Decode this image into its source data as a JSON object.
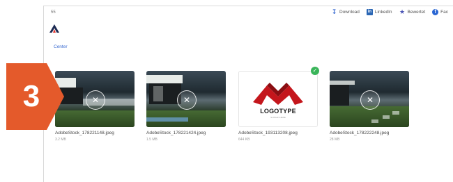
{
  "topbar": {
    "count": "55",
    "links": [
      {
        "label": "Download",
        "icon": "download-icon"
      },
      {
        "label": "LinkedIn",
        "icon": "linkedin-icon"
      },
      {
        "label": "Bewertet",
        "icon": "star-icon"
      },
      {
        "label": "Fac",
        "icon": "facebook-icon"
      }
    ]
  },
  "breadcrumb": "Center",
  "step": "3",
  "colors": {
    "accent": "#e45a2b",
    "link": "#3a6bd1",
    "check": "#3ab55a"
  },
  "files": [
    {
      "name": "AdobeStock_178221148.jpeg",
      "size": "3.2 MB",
      "selected": false
    },
    {
      "name": "AdobeStock_178221424.jpeg",
      "size": "1.5 MB",
      "selected": false
    },
    {
      "name": "AdobeStock_193113208.jpeg",
      "size": "644 KB",
      "selected": true,
      "logo_text": "LOGOTYPE",
      "logo_tagline": "SLOGAN HERE"
    },
    {
      "name": "AdobeStock_178222248.jpeg",
      "size": "28 MB",
      "selected": false
    }
  ]
}
